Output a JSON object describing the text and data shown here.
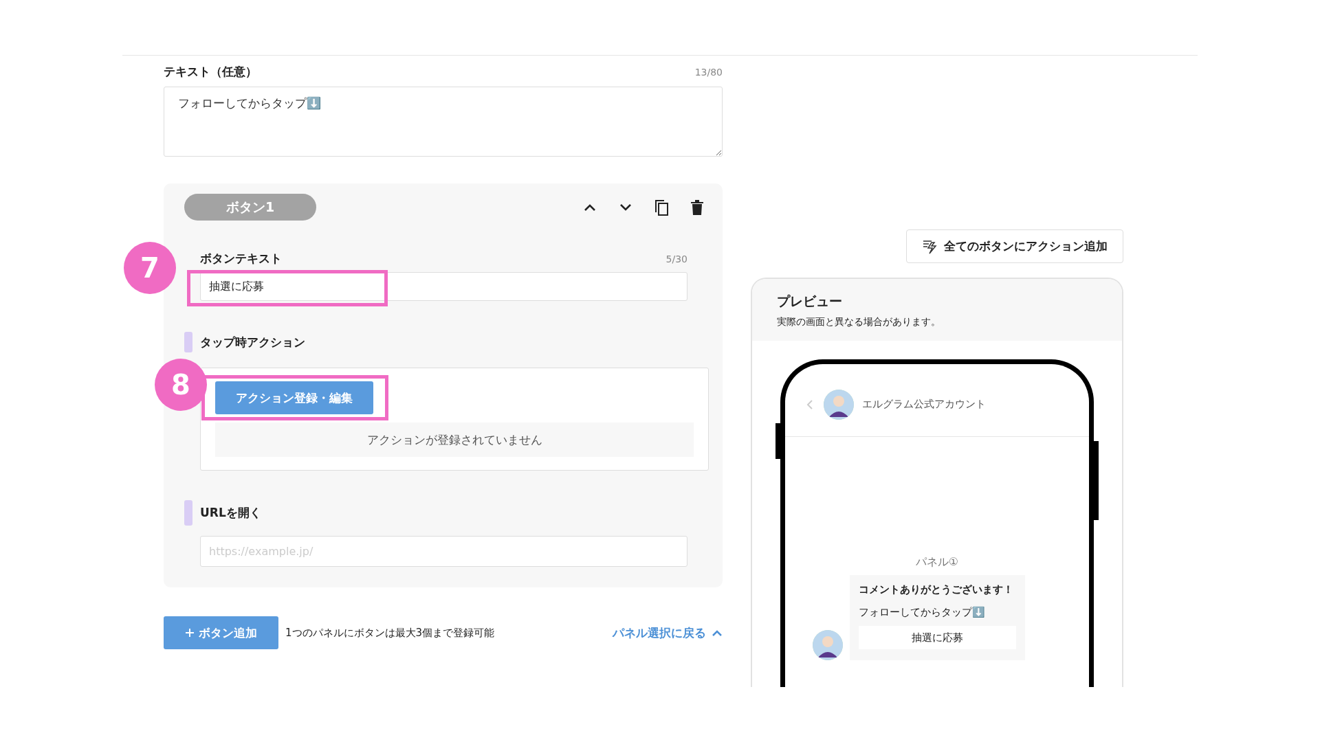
{
  "text_field": {
    "label": "テキスト（任意）",
    "counter": "13/80",
    "value": "フォローしてからタップ⬇️"
  },
  "button_card": {
    "title": "ボタン1",
    "button_text": {
      "label": "ボタンテキスト",
      "counter": "5/30",
      "value": "抽選に応募"
    },
    "tap_action": {
      "label": "タップ時アクション",
      "button": "アクション登録・編集",
      "empty": "アクションが登録されていません"
    },
    "url": {
      "label": "URLを開く",
      "placeholder": "https://example.jp/"
    }
  },
  "annotations": [
    {
      "number": "7"
    },
    {
      "number": "8"
    }
  ],
  "footer": {
    "add_button": "ボタン追加",
    "note": "1つのパネルにボタンは最大3個まで登録可能",
    "back_link": "パネル選択に戻る"
  },
  "add_all_button": "全てのボタンにアクション追加",
  "preview": {
    "title": "プレビュー",
    "note": "実際の画面と異なる場合があります。",
    "account": "エルグラム公式アカウント",
    "panel_label": "パネル①",
    "bubble_title": "コメントありがとうございます！",
    "bubble_text": "フォローしてからタップ⬇️",
    "bubble_button": "抽選に応募"
  }
}
